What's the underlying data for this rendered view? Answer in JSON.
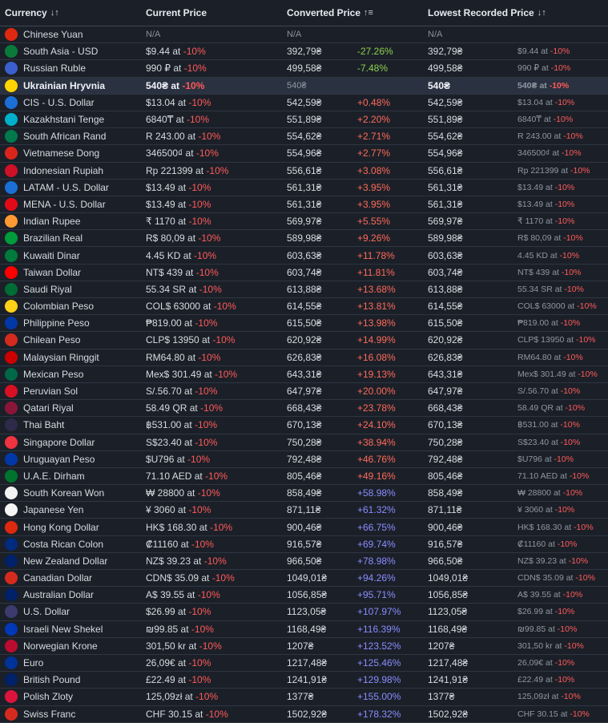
{
  "headers": {
    "currency": "Currency",
    "current_price": "Current Price",
    "converted_price": "Converted Price",
    "lowest_recorded": "Lowest Recorded Price",
    "sort_icon_currency": "↓↑",
    "sort_icon_converted": "↑≡",
    "sort_icon_lowest": "↓↑"
  },
  "rows": [
    {
      "name": "Chinese Yuan",
      "flag": "#de2910",
      "price": "N/A",
      "discount": "",
      "converted": "N/A",
      "diff": "",
      "low": "N/A",
      "low_price": "",
      "low_discount": "",
      "na": true
    },
    {
      "name": "South Asia - USD",
      "flag": "#0a7a3a",
      "price": "$9.44 at",
      "discount": "-10%",
      "converted": "392,79₴",
      "diff": "-27.26%",
      "diffc": "green",
      "low": "392,79₴",
      "low_price": "$9.44 at",
      "low_discount": "-10%"
    },
    {
      "name": "Russian Ruble",
      "flag": "#3a5fcd",
      "price": "990 ₽ at",
      "discount": "-10%",
      "converted": "499,58₴",
      "diff": "-7.48%",
      "diffc": "green",
      "low": "499,58₴",
      "low_price": "990 ₽ at",
      "low_discount": "-10%"
    },
    {
      "name": "Ukrainian Hryvnia",
      "flag": "#ffd500",
      "price": "540₴ at",
      "discount": "-10%",
      "converted": "540₴",
      "diff": "",
      "low": "540₴",
      "low_price": "540₴ at",
      "low_discount": "-10%",
      "hl": true
    },
    {
      "name": "CIS - U.S. Dollar",
      "flag": "#1b6fd6",
      "price": "$13.04 at",
      "discount": "-10%",
      "converted": "542,59₴",
      "diff": "+0.48%",
      "diffc": "red",
      "low": "542,59₴",
      "low_price": "$13.04 at",
      "low_discount": "-10%"
    },
    {
      "name": "Kazakhstani Tenge",
      "flag": "#00afca",
      "price": "6840₸ at",
      "discount": "-10%",
      "converted": "551,89₴",
      "diff": "+2.20%",
      "diffc": "red",
      "low": "551,89₴",
      "low_price": "6840₸ at",
      "low_discount": "-10%"
    },
    {
      "name": "South African Rand",
      "flag": "#007a4d",
      "price": "R 243.00 at",
      "discount": "-10%",
      "converted": "554,62₴",
      "diff": "+2.71%",
      "diffc": "red",
      "low": "554,62₴",
      "low_price": "R 243.00 at",
      "low_discount": "-10%"
    },
    {
      "name": "Vietnamese Dong",
      "flag": "#da251d",
      "price": "346500₫ at",
      "discount": "-10%",
      "converted": "554,96₴",
      "diff": "+2.77%",
      "diffc": "red",
      "low": "554,96₴",
      "low_price": "346500₫ at",
      "low_discount": "-10%"
    },
    {
      "name": "Indonesian Rupiah",
      "flag": "#ce1126",
      "price": "Rp 221399 at",
      "discount": "-10%",
      "converted": "556,61₴",
      "diff": "+3.08%",
      "diffc": "red",
      "low": "556,61₴",
      "low_price": "Rp 221399 at",
      "low_discount": "-10%"
    },
    {
      "name": "LATAM - U.S. Dollar",
      "flag": "#1b6fd6",
      "price": "$13.49 at",
      "discount": "-10%",
      "converted": "561,31₴",
      "diff": "+3.95%",
      "diffc": "red",
      "low": "561,31₴",
      "low_price": "$13.49 at",
      "low_discount": "-10%"
    },
    {
      "name": "MENA - U.S. Dollar",
      "flag": "#e30a17",
      "price": "$13.49 at",
      "discount": "-10%",
      "converted": "561,31₴",
      "diff": "+3.95%",
      "diffc": "red",
      "low": "561,31₴",
      "low_price": "$13.49 at",
      "low_discount": "-10%"
    },
    {
      "name": "Indian Rupee",
      "flag": "#ff9933",
      "price": "₹ 1170 at",
      "discount": "-10%",
      "converted": "569,97₴",
      "diff": "+5.55%",
      "diffc": "red",
      "low": "569,97₴",
      "low_price": "₹ 1170 at",
      "low_discount": "-10%"
    },
    {
      "name": "Brazilian Real",
      "flag": "#009c3b",
      "price": "R$ 80,09 at",
      "discount": "-10%",
      "converted": "589,98₴",
      "diff": "+9.26%",
      "diffc": "red",
      "low": "589,98₴",
      "low_price": "R$ 80,09 at",
      "low_discount": "-10%"
    },
    {
      "name": "Kuwaiti Dinar",
      "flag": "#007a3d",
      "price": "4.45 KD at",
      "discount": "-10%",
      "converted": "603,63₴",
      "diff": "+11.78%",
      "diffc": "red",
      "low": "603,63₴",
      "low_price": "4.45 KD at",
      "low_discount": "-10%"
    },
    {
      "name": "Taiwan Dollar",
      "flag": "#fe0000",
      "price": "NT$ 439 at",
      "discount": "-10%",
      "converted": "603,74₴",
      "diff": "+11.81%",
      "diffc": "red",
      "low": "603,74₴",
      "low_price": "NT$ 439 at",
      "low_discount": "-10%"
    },
    {
      "name": "Saudi Riyal",
      "flag": "#006c35",
      "price": "55.34 SR at",
      "discount": "-10%",
      "converted": "613,88₴",
      "diff": "+13.68%",
      "diffc": "red",
      "low": "613,88₴",
      "low_price": "55.34 SR at",
      "low_discount": "-10%"
    },
    {
      "name": "Colombian Peso",
      "flag": "#fcd116",
      "price": "COL$ 63000 at",
      "discount": "-10%",
      "converted": "614,55₴",
      "diff": "+13.81%",
      "diffc": "red",
      "low": "614,55₴",
      "low_price": "COL$ 63000 at",
      "low_discount": "-10%"
    },
    {
      "name": "Philippine Peso",
      "flag": "#0038a8",
      "price": "₱819.00 at",
      "discount": "-10%",
      "converted": "615,50₴",
      "diff": "+13.98%",
      "diffc": "red",
      "low": "615,50₴",
      "low_price": "₱819.00 at",
      "low_discount": "-10%"
    },
    {
      "name": "Chilean Peso",
      "flag": "#d52b1e",
      "price": "CLP$ 13950 at",
      "discount": "-10%",
      "converted": "620,92₴",
      "diff": "+14.99%",
      "diffc": "red",
      "low": "620,92₴",
      "low_price": "CLP$ 13950 at",
      "low_discount": "-10%"
    },
    {
      "name": "Malaysian Ringgit",
      "flag": "#cc0001",
      "price": "RM64.80 at",
      "discount": "-10%",
      "converted": "626,83₴",
      "diff": "+16.08%",
      "diffc": "red",
      "low": "626,83₴",
      "low_price": "RM64.80 at",
      "low_discount": "-10%"
    },
    {
      "name": "Mexican Peso",
      "flag": "#006847",
      "price": "Mex$ 301.49 at",
      "discount": "-10%",
      "converted": "643,31₴",
      "diff": "+19.13%",
      "diffc": "red",
      "low": "643,31₴",
      "low_price": "Mex$ 301.49 at",
      "low_discount": "-10%"
    },
    {
      "name": "Peruvian Sol",
      "flag": "#d91023",
      "price": "S/.56.70 at",
      "discount": "-10%",
      "converted": "647,97₴",
      "diff": "+20.00%",
      "diffc": "red",
      "low": "647,97₴",
      "low_price": "S/.56.70 at",
      "low_discount": "-10%"
    },
    {
      "name": "Qatari Riyal",
      "flag": "#8a1538",
      "price": "58.49 QR at",
      "discount": "-10%",
      "converted": "668,43₴",
      "diff": "+23.78%",
      "diffc": "red",
      "low": "668,43₴",
      "low_price": "58.49 QR at",
      "low_discount": "-10%"
    },
    {
      "name": "Thai Baht",
      "flag": "#2d2a4a",
      "price": "฿531.00 at",
      "discount": "-10%",
      "converted": "670,13₴",
      "diff": "+24.10%",
      "diffc": "red",
      "low": "670,13₴",
      "low_price": "฿531.00 at",
      "low_discount": "-10%"
    },
    {
      "name": "Singapore Dollar",
      "flag": "#ef3340",
      "price": "S$23.40 at",
      "discount": "-10%",
      "converted": "750,28₴",
      "diff": "+38.94%",
      "diffc": "red",
      "low": "750,28₴",
      "low_price": "S$23.40 at",
      "low_discount": "-10%"
    },
    {
      "name": "Uruguayan Peso",
      "flag": "#0038a8",
      "price": "$U796 at",
      "discount": "-10%",
      "converted": "792,48₴",
      "diff": "+46.76%",
      "diffc": "red",
      "low": "792,48₴",
      "low_price": "$U796 at",
      "low_discount": "-10%"
    },
    {
      "name": "U.A.E. Dirham",
      "flag": "#00732f",
      "price": "71.10 AED at",
      "discount": "-10%",
      "converted": "805,46₴",
      "diff": "+49.16%",
      "diffc": "red",
      "low": "805,46₴",
      "low_price": "71.10 AED at",
      "low_discount": "-10%"
    },
    {
      "name": "South Korean Won",
      "flag": "#f2f2f2",
      "price": "₩ 28800 at",
      "discount": "-10%",
      "converted": "858,49₴",
      "diff": "+58.98%",
      "diffc": "blue",
      "low": "858,49₴",
      "low_price": "₩ 28800 at",
      "low_discount": "-10%"
    },
    {
      "name": "Japanese Yen",
      "flag": "#f5f5f5",
      "price": "¥ 3060 at",
      "discount": "-10%",
      "converted": "871,11₴",
      "diff": "+61.32%",
      "diffc": "blue",
      "low": "871,11₴",
      "low_price": "¥ 3060 at",
      "low_discount": "-10%"
    },
    {
      "name": "Hong Kong Dollar",
      "flag": "#de2910",
      "price": "HK$ 168.30 at",
      "discount": "-10%",
      "converted": "900,46₴",
      "diff": "+66.75%",
      "diffc": "blue",
      "low": "900,46₴",
      "low_price": "HK$ 168.30 at",
      "low_discount": "-10%"
    },
    {
      "name": "Costa Rican Colon",
      "flag": "#002b7f",
      "price": "₡11160 at",
      "discount": "-10%",
      "converted": "916,57₴",
      "diff": "+69.74%",
      "diffc": "blue",
      "low": "916,57₴",
      "low_price": "₡11160 at",
      "low_discount": "-10%"
    },
    {
      "name": "New Zealand Dollar",
      "flag": "#012169",
      "price": "NZ$ 39.23 at",
      "discount": "-10%",
      "converted": "966,50₴",
      "diff": "+78.98%",
      "diffc": "blue",
      "low": "966,50₴",
      "low_price": "NZ$ 39.23 at",
      "low_discount": "-10%"
    },
    {
      "name": "Canadian Dollar",
      "flag": "#d52b1e",
      "price": "CDN$ 35.09 at",
      "discount": "-10%",
      "converted": "1049,01₴",
      "diff": "+94.26%",
      "diffc": "blue",
      "low": "1049,01₴",
      "low_price": "CDN$ 35.09 at",
      "low_discount": "-10%"
    },
    {
      "name": "Australian Dollar",
      "flag": "#012169",
      "price": "A$ 39.55 at",
      "discount": "-10%",
      "converted": "1056,85₴",
      "diff": "+95.71%",
      "diffc": "blue",
      "low": "1056,85₴",
      "low_price": "A$ 39.55 at",
      "low_discount": "-10%"
    },
    {
      "name": "U.S. Dollar",
      "flag": "#3c3b6e",
      "price": "$26.99 at",
      "discount": "-10%",
      "converted": "1123,05₴",
      "diff": "+107.97%",
      "diffc": "blue",
      "low": "1123,05₴",
      "low_price": "$26.99 at",
      "low_discount": "-10%"
    },
    {
      "name": "Israeli New Shekel",
      "flag": "#0038b8",
      "price": "₪99.85 at",
      "discount": "-10%",
      "converted": "1168,49₴",
      "diff": "+116.39%",
      "diffc": "blue",
      "low": "1168,49₴",
      "low_price": "₪99.85 at",
      "low_discount": "-10%"
    },
    {
      "name": "Norwegian Krone",
      "flag": "#ba0c2f",
      "price": "301,50 kr at",
      "discount": "-10%",
      "converted": "1207₴",
      "diff": "+123.52%",
      "diffc": "blue",
      "low": "1207₴",
      "low_price": "301,50 kr at",
      "low_discount": "-10%"
    },
    {
      "name": "Euro",
      "flag": "#003399",
      "price": "26,09€ at",
      "discount": "-10%",
      "converted": "1217,48₴",
      "diff": "+125.46%",
      "diffc": "blue",
      "low": "1217,48₴",
      "low_price": "26,09€ at",
      "low_discount": "-10%"
    },
    {
      "name": "British Pound",
      "flag": "#012169",
      "price": "£22.49 at",
      "discount": "-10%",
      "converted": "1241,91₴",
      "diff": "+129.98%",
      "diffc": "blue",
      "low": "1241,91₴",
      "low_price": "£22.49 at",
      "low_discount": "-10%"
    },
    {
      "name": "Polish Zloty",
      "flag": "#dc143c",
      "price": "125,09zł at",
      "discount": "-10%",
      "converted": "1377₴",
      "diff": "+155.00%",
      "diffc": "blue",
      "low": "1377₴",
      "low_price": "125,09zł at",
      "low_discount": "-10%"
    },
    {
      "name": "Swiss Franc",
      "flag": "#d52b1e",
      "price": "CHF 30.15 at",
      "discount": "-10%",
      "converted": "1502,92₴",
      "diff": "+178.32%",
      "diffc": "blue",
      "low": "1502,92₴",
      "low_price": "CHF 30.15 at",
      "low_discount": "-10%"
    }
  ]
}
